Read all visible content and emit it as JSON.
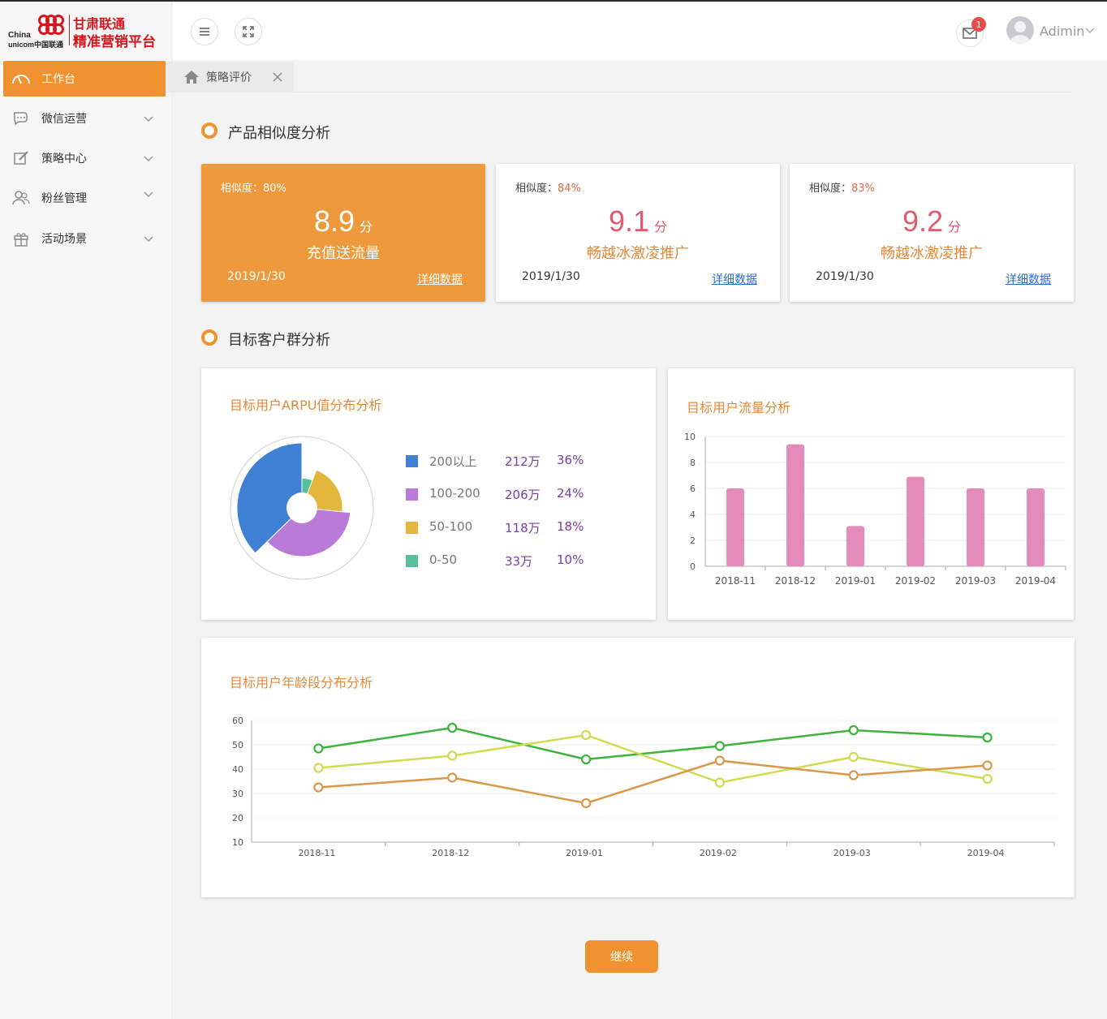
{
  "brand": {
    "en_line1": "China",
    "en_line2": "unicom中国联通",
    "cn_line1": "甘肃联通",
    "cn_line2": "精准营销平台"
  },
  "sidebar": {
    "items": [
      {
        "label": "工作台",
        "icon": "dashboard-icon",
        "active": true
      },
      {
        "label": "微信运营",
        "icon": "chat-icon"
      },
      {
        "label": "策略中心",
        "icon": "edit-icon"
      },
      {
        "label": "粉丝管理",
        "icon": "users-icon"
      },
      {
        "label": "活动场景",
        "icon": "gift-icon"
      }
    ]
  },
  "topbar": {
    "menu_icon": "hamburger-icon",
    "fullscreen_icon": "fullscreen-icon",
    "mail_icon": "mail-icon",
    "mail_badge": "1",
    "username": "Adimin"
  },
  "tabs": [
    {
      "label": "策略评价",
      "icon": "home-icon"
    }
  ],
  "section1": {
    "title": "产品相似度分析"
  },
  "score_cards": [
    {
      "sim_label": "相似度：",
      "sim_value": "80%",
      "score": "8.9",
      "unit": "分",
      "product": "充值送流量",
      "date": "2019/1/30",
      "detail": "详细数据"
    },
    {
      "sim_label": "相似度：",
      "sim_value": "84%",
      "score": "9.1",
      "unit": "分",
      "product": "畅越冰激凌推广",
      "date": "2019/1/30",
      "detail": "详细数据"
    },
    {
      "sim_label": "相似度：",
      "sim_value": "83%",
      "score": "9.2",
      "unit": "分",
      "product": "畅越冰激凌推广",
      "date": "2019/1/30",
      "detail": "详细数据"
    }
  ],
  "section2": {
    "title": "目标客户群分析"
  },
  "arpu": {
    "title": "目标用户ARPU值分布分析",
    "legend": [
      {
        "name": "200以上",
        "value": "212万",
        "pct": "36%",
        "color": "#3f7fd4"
      },
      {
        "name": "100-200",
        "value": "206万",
        "pct": "24%",
        "color": "#b97ad8"
      },
      {
        "name": "50-100",
        "value": "118万",
        "pct": "18%",
        "color": "#e2b73c"
      },
      {
        "name": "0-50",
        "value": "33万",
        "pct": "10%",
        "color": "#55c09a"
      }
    ]
  },
  "traffic": {
    "title": "目标用户流量分析"
  },
  "age": {
    "title": "目标用户年龄段分布分析"
  },
  "continue_label": "继续",
  "chart_data": [
    {
      "type": "pie",
      "title": "目标用户ARPU值分布分析",
      "categories": [
        "200以上",
        "100-200",
        "50-100",
        "0-50"
      ],
      "values": [
        212,
        206,
        118,
        33
      ],
      "percent": [
        36,
        24,
        18,
        10
      ],
      "colors": [
        "#3f7fd4",
        "#b97ad8",
        "#e2b73c",
        "#55c09a"
      ]
    },
    {
      "type": "bar",
      "title": "目标用户流量分析",
      "categories": [
        "2018-11",
        "2018-12",
        "2019-01",
        "2019-02",
        "2019-03",
        "2019-04"
      ],
      "values": [
        6,
        9.4,
        3.1,
        6.9,
        6,
        6
      ],
      "ylim": [
        0,
        10
      ],
      "yticks": [
        0,
        2,
        4,
        6,
        8,
        10
      ],
      "color": "#e38bbb",
      "grid": true
    },
    {
      "type": "line",
      "title": "目标用户年龄段分布分析",
      "categories": [
        "2018-11",
        "2018-12",
        "2019-01",
        "2019-02",
        "2019-03",
        "2019-04"
      ],
      "ylim": [
        10,
        60
      ],
      "yticks": [
        10,
        20,
        30,
        40,
        50,
        60
      ],
      "grid": true,
      "series": [
        {
          "color": "#3cb43c",
          "values": [
            48.5,
            57,
            44,
            49.5,
            56,
            53
          ]
        },
        {
          "color": "#cfdc50",
          "values": [
            40.5,
            45.5,
            54,
            34.5,
            45,
            36
          ]
        },
        {
          "color": "#d9984a",
          "values": [
            32.5,
            36.5,
            26,
            43.5,
            37.5,
            41.5
          ]
        }
      ]
    }
  ]
}
